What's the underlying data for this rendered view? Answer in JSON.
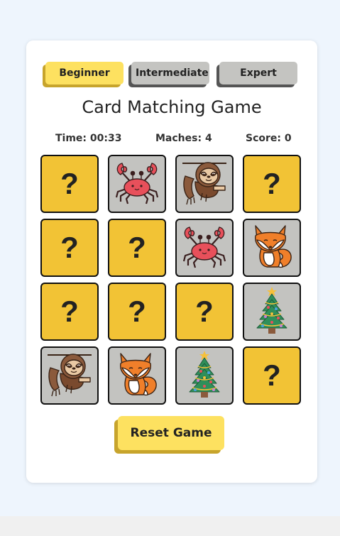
{
  "levels": {
    "beginner": "Beginner",
    "intermediate": "Intermediate",
    "expert": "Expert",
    "active": "Beginner"
  },
  "title": "Card Matching Game",
  "stats": {
    "time": "Time: 00:33",
    "matches": "Maches: 4",
    "score": "Score: 0"
  },
  "colors": {
    "card_hidden": "#f2c335",
    "card_revealed": "#c3c3c0",
    "active_button": "#fde160",
    "inactive_button": "#c4c4c1"
  },
  "cards": [
    {
      "state": "hidden",
      "label": "?"
    },
    {
      "state": "revealed",
      "icon": "crab-icon"
    },
    {
      "state": "revealed",
      "icon": "sloth-icon"
    },
    {
      "state": "hidden",
      "label": "?"
    },
    {
      "state": "hidden",
      "label": "?"
    },
    {
      "state": "hidden",
      "label": "?"
    },
    {
      "state": "revealed",
      "icon": "crab-icon"
    },
    {
      "state": "revealed",
      "icon": "fox-icon"
    },
    {
      "state": "hidden",
      "label": "?"
    },
    {
      "state": "hidden",
      "label": "?"
    },
    {
      "state": "hidden",
      "label": "?"
    },
    {
      "state": "revealed",
      "icon": "christmas-tree-icon"
    },
    {
      "state": "revealed",
      "icon": "sloth-icon"
    },
    {
      "state": "revealed",
      "icon": "fox-icon"
    },
    {
      "state": "revealed",
      "icon": "christmas-tree-icon"
    },
    {
      "state": "hidden",
      "label": "?"
    }
  ],
  "reset_label": "Reset Game"
}
